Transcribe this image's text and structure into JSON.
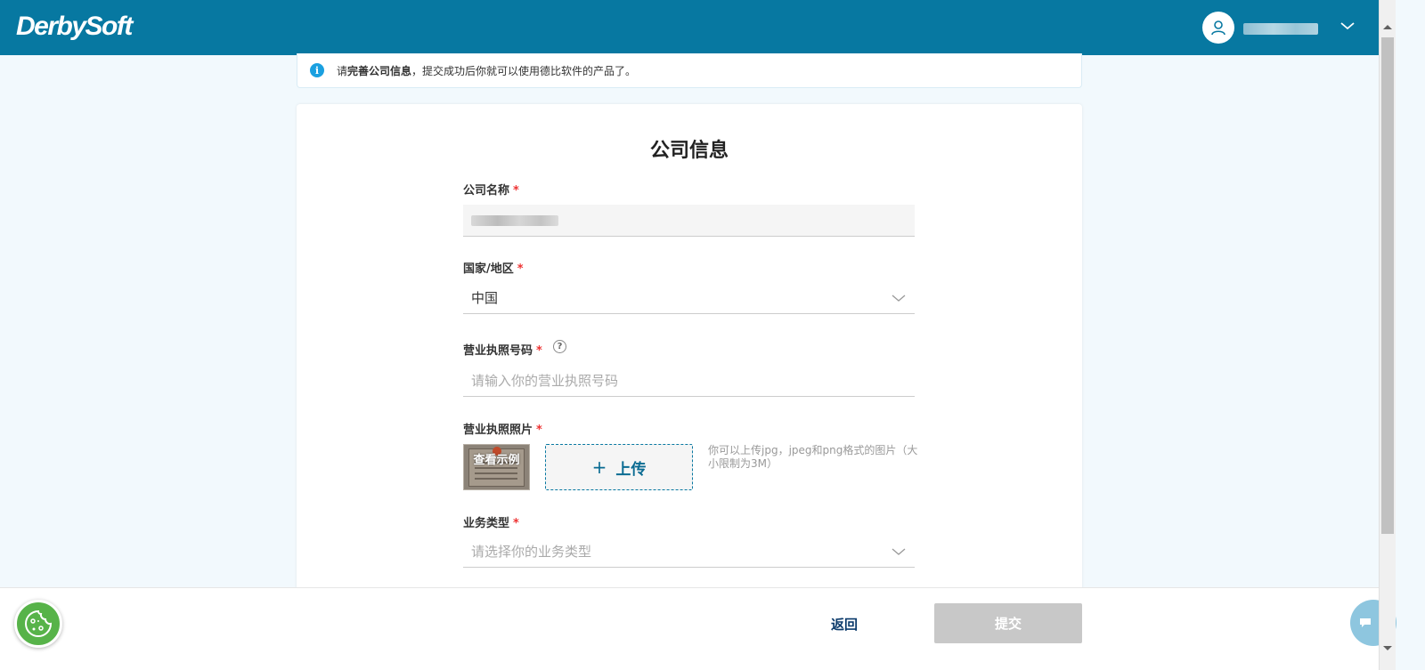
{
  "header": {
    "logo": "DerbySoft",
    "user_menu": {
      "avatar_icon": "user-icon",
      "chevron_icon": "chevron-down-icon"
    }
  },
  "notice": {
    "prefix": "请",
    "bold": "完善公司信息",
    "suffix": "，提交成功后你就可以使用德比软件的产品了。",
    "icon": "info-icon"
  },
  "form": {
    "title": "公司信息",
    "company_name": {
      "label": "公司名称",
      "required": "*"
    },
    "country": {
      "label": "国家/地区",
      "required": "*",
      "value": "中国"
    },
    "license_no": {
      "label": "营业执照号码",
      "required": "*",
      "placeholder": "请输入你的营业执照号码",
      "help": "?"
    },
    "license_photo": {
      "label": "营业执照照片",
      "required": "*",
      "sample_label": "查看示例",
      "upload_plus": "+",
      "upload_label": "上传",
      "hint": "你可以上传jpg，jpeg和png格式的图片（大小限制为3M）"
    },
    "business_type": {
      "label": "业务类型",
      "required": "*",
      "placeholder": "请选择你的业务类型"
    }
  },
  "footer": {
    "back_label": "返回",
    "submit_label": "提交"
  },
  "colors": {
    "header_bg": "#0778a1",
    "accent": "#0778a1",
    "required": "#ee3333",
    "submit_disabled": "#c8c8c8",
    "cookie_badge": "#57b349"
  }
}
